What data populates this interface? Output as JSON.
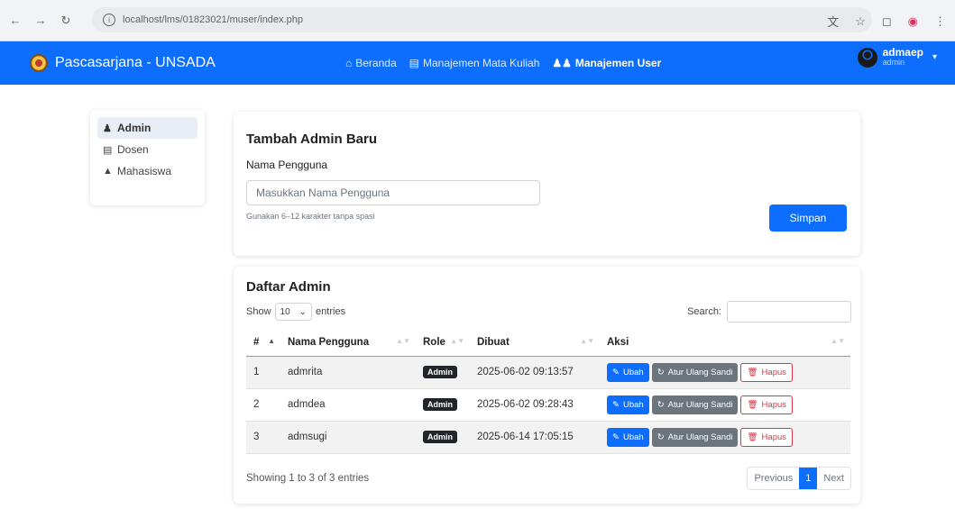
{
  "browser": {
    "url": "localhost/lms/01823021/muser/index.php",
    "icons": [
      "back-icon",
      "forward-icon",
      "reload-icon",
      "info-icon",
      "translate-icon",
      "star-icon",
      "extensions-icon",
      "profile-icon",
      "menu-icon"
    ]
  },
  "navbar": {
    "brand": "Pascasarjana - UNSADA",
    "links": [
      {
        "label": "Beranda",
        "icon": "home-icon"
      },
      {
        "label": "Manajemen Mata Kuliah",
        "icon": "book-icon"
      },
      {
        "label": "Manajemen User",
        "icon": "users-icon",
        "active": true
      }
    ],
    "user": {
      "name": "admaep",
      "role": "admin"
    }
  },
  "sidebar": {
    "items": [
      {
        "label": "Admin",
        "icon": "users-icon",
        "active": true
      },
      {
        "label": "Dosen",
        "icon": "id-card-icon"
      },
      {
        "label": "Mahasiswa",
        "icon": "graduation-cap-icon"
      }
    ]
  },
  "add_form": {
    "title": "Tambah Admin Baru",
    "username_label": "Nama Pengguna",
    "username_placeholder": "Masukkan Nama Pengguna",
    "help": "Gunakan 6–12 karakter tanpa spasi",
    "save_label": "Simpan"
  },
  "admin_list": {
    "title": "Daftar Admin",
    "length": {
      "show": "Show",
      "value": "10",
      "entries": "entries"
    },
    "search_label": "Search:",
    "columns": [
      "#",
      "Nama Pengguna",
      "Role",
      "Dibuat",
      "Aksi"
    ],
    "rows": [
      {
        "no": "1",
        "username": "admrita",
        "role": "Admin",
        "created": "2025-06-02 09:13:57"
      },
      {
        "no": "2",
        "username": "admdea",
        "role": "Admin",
        "created": "2025-06-02 09:28:43"
      },
      {
        "no": "3",
        "username": "admsugi",
        "role": "Admin",
        "created": "2025-06-14 17:05:15"
      }
    ],
    "actions": {
      "edit": "Ubah",
      "reset": "Atur Ulang Sandi",
      "delete": "Hapus"
    },
    "info": "Showing 1 to 3 of 3 entries",
    "pagination": {
      "previous": "Previous",
      "current": "1",
      "next": "Next"
    }
  },
  "colors": {
    "primary": "#0d6efd",
    "secondary": "#6c757d",
    "danger": "#dc3545",
    "dark": "#212529"
  }
}
